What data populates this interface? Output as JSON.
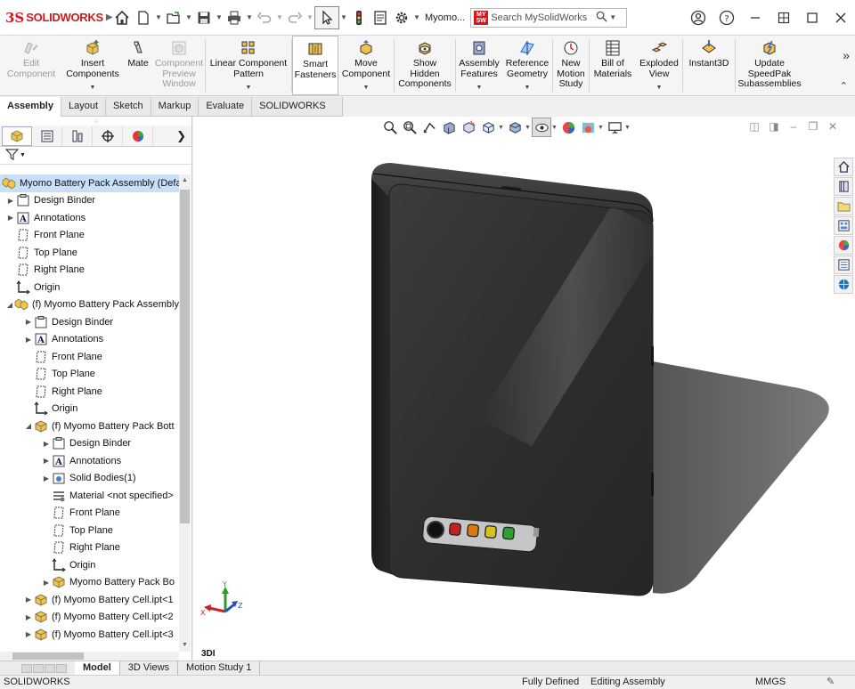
{
  "app": {
    "brand_mark": "3S",
    "brand_name": "SOLIDWORKS",
    "document_title": "Myomo..."
  },
  "search": {
    "badge": "MY SW",
    "placeholder": "Search MySolidWorks"
  },
  "toolbar": {
    "items": [
      {
        "id": "edit-component",
        "label": "Edit\nComponent",
        "icon": "edit-component-icon",
        "enabled": false,
        "dropdown": false
      },
      {
        "id": "insert-components",
        "label": "Insert\nComponents",
        "icon": "insert-components-icon",
        "enabled": true,
        "dropdown": true
      },
      {
        "id": "mate",
        "label": "Mate",
        "icon": "mate-icon",
        "enabled": true,
        "dropdown": false
      },
      {
        "id": "component-preview",
        "label": "Component\nPreview\nWindow",
        "icon": "component-preview-icon",
        "enabled": false,
        "dropdown": false
      },
      {
        "id": "linear-pattern",
        "label": "Linear Component\nPattern",
        "icon": "linear-pattern-icon",
        "enabled": true,
        "dropdown": true
      },
      {
        "id": "smart-fasteners",
        "label": "Smart\nFasteners",
        "icon": "smart-fasteners-icon",
        "enabled": true,
        "dropdown": false
      },
      {
        "id": "move-component",
        "label": "Move\nComponent",
        "icon": "move-component-icon",
        "enabled": true,
        "dropdown": true
      },
      {
        "id": "show-hidden",
        "label": "Show\nHidden\nComponents",
        "icon": "show-hidden-icon",
        "enabled": true,
        "dropdown": false
      },
      {
        "id": "assembly-features",
        "label": "Assembly\nFeatures",
        "icon": "assembly-features-icon",
        "enabled": true,
        "dropdown": true
      },
      {
        "id": "reference-geometry",
        "label": "Reference\nGeometry",
        "icon": "reference-geometry-icon",
        "enabled": true,
        "dropdown": true
      },
      {
        "id": "new-motion-study",
        "label": "New\nMotion\nStudy",
        "icon": "motion-study-icon",
        "enabled": true,
        "dropdown": false
      },
      {
        "id": "bill-of-materials",
        "label": "Bill of\nMaterials",
        "icon": "bom-icon",
        "enabled": true,
        "dropdown": false
      },
      {
        "id": "exploded-view",
        "label": "Exploded\nView",
        "icon": "exploded-view-icon",
        "enabled": true,
        "dropdown": true
      },
      {
        "id": "instant3d",
        "label": "Instant3D",
        "icon": "instant3d-icon",
        "enabled": true,
        "dropdown": false
      },
      {
        "id": "update-speedpak",
        "label": "Update\nSpeedPak\nSubassemblies",
        "icon": "speedpak-icon",
        "enabled": true,
        "dropdown": false
      }
    ]
  },
  "tabs": [
    "Assembly",
    "Layout",
    "Sketch",
    "Markup",
    "Evaluate",
    "SOLIDWORKS Add-Ins"
  ],
  "active_tab": "Assembly",
  "tree": [
    {
      "label": "Myomo Battery Pack Assembly  (Defa",
      "indent": 0,
      "expand": "",
      "icon": "assembly",
      "selected": true
    },
    {
      "label": "Design Binder",
      "indent": 1,
      "expand": "▶",
      "icon": "binder"
    },
    {
      "label": "Annotations",
      "indent": 1,
      "expand": "▶",
      "icon": "annotations"
    },
    {
      "label": "Front Plane",
      "indent": 1,
      "expand": "",
      "icon": "plane"
    },
    {
      "label": "Top Plane",
      "indent": 1,
      "expand": "",
      "icon": "plane"
    },
    {
      "label": "Right Plane",
      "indent": 1,
      "expand": "",
      "icon": "plane"
    },
    {
      "label": "Origin",
      "indent": 1,
      "expand": "",
      "icon": "origin"
    },
    {
      "label": "(f) Myomo Battery Pack Assembly",
      "indent": 1,
      "expand": "◢",
      "icon": "assembly"
    },
    {
      "label": "Design Binder",
      "indent": 2,
      "expand": "▶",
      "icon": "binder"
    },
    {
      "label": "Annotations",
      "indent": 2,
      "expand": "▶",
      "icon": "annotations"
    },
    {
      "label": "Front Plane",
      "indent": 2,
      "expand": "",
      "icon": "plane"
    },
    {
      "label": "Top Plane",
      "indent": 2,
      "expand": "",
      "icon": "plane"
    },
    {
      "label": "Right Plane",
      "indent": 2,
      "expand": "",
      "icon": "plane"
    },
    {
      "label": "Origin",
      "indent": 2,
      "expand": "",
      "icon": "origin"
    },
    {
      "label": "(f) Myomo Battery Pack Bott",
      "indent": 2,
      "expand": "◢",
      "icon": "part"
    },
    {
      "label": "Design Binder",
      "indent": 3,
      "expand": "▶",
      "icon": "binder"
    },
    {
      "label": "Annotations",
      "indent": 3,
      "expand": "▶",
      "icon": "annotations"
    },
    {
      "label": "Solid Bodies(1)",
      "indent": 3,
      "expand": "▶",
      "icon": "solid"
    },
    {
      "label": "Material <not specified>",
      "indent": 3,
      "expand": "",
      "icon": "material"
    },
    {
      "label": "Front Plane",
      "indent": 3,
      "expand": "",
      "icon": "plane"
    },
    {
      "label": "Top Plane",
      "indent": 3,
      "expand": "",
      "icon": "plane"
    },
    {
      "label": "Right Plane",
      "indent": 3,
      "expand": "",
      "icon": "plane"
    },
    {
      "label": "Origin",
      "indent": 3,
      "expand": "",
      "icon": "origin"
    },
    {
      "label": "Myomo Battery Pack Bo",
      "indent": 3,
      "expand": "▶",
      "icon": "part"
    },
    {
      "label": "(f) Myomo Battery Cell.ipt<1",
      "indent": 2,
      "expand": "▶",
      "icon": "part"
    },
    {
      "label": "(f) Myomo Battery Cell.ipt<2",
      "indent": 2,
      "expand": "▶",
      "icon": "part"
    },
    {
      "label": "(f) Myomo Battery Cell.ipt<3",
      "indent": 2,
      "expand": "▶",
      "icon": "part"
    }
  ],
  "viewport": {
    "label": "3DI",
    "led_colors": [
      "#c42020",
      "#d97a10",
      "#d6c21c",
      "#2da12d"
    ],
    "triad": {
      "x": "X",
      "y": "Y",
      "z": "Z"
    }
  },
  "bottom_tabs": [
    "Model",
    "3D Views",
    "Motion Study 1"
  ],
  "active_bottom_tab": "Model",
  "status": {
    "app": "SOLIDWORKS",
    "state": "Fully Defined",
    "mode": "Editing Assembly",
    "units": "MMGS"
  }
}
